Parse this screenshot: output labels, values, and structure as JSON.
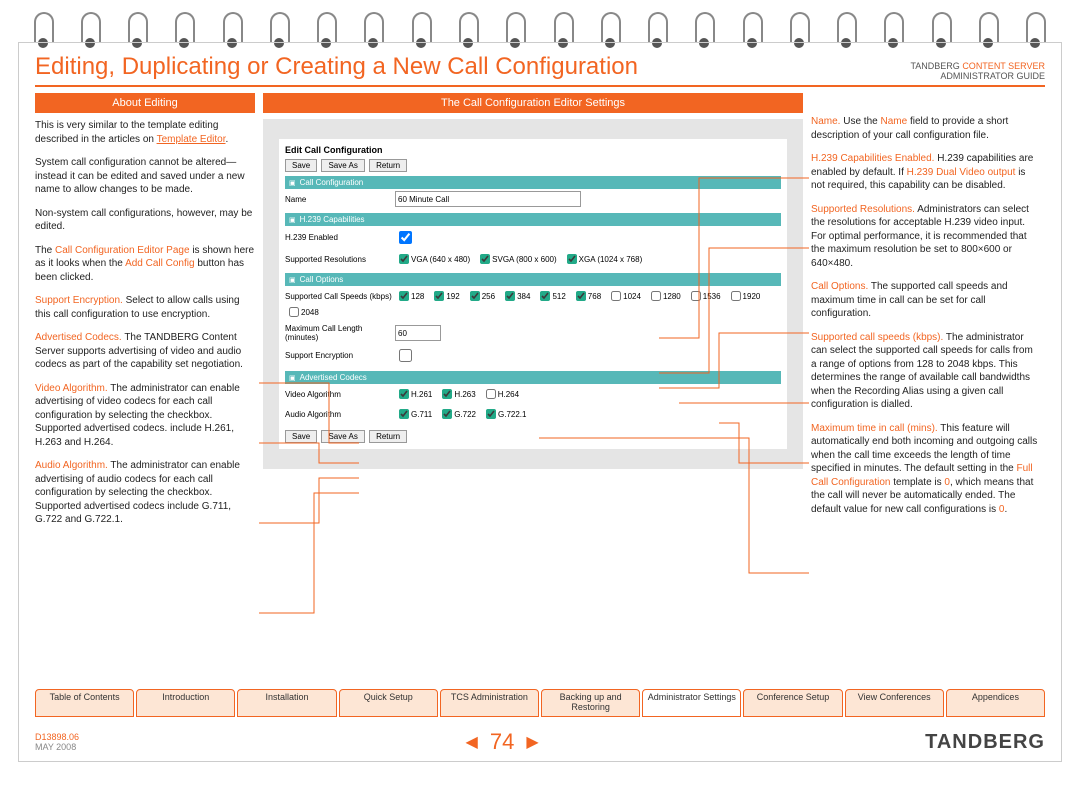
{
  "header": {
    "title": "Editing, Duplicating or Creating a New Call Configuration",
    "brand_prefix": "TANDBERG ",
    "brand_cs": "CONTENT SERVER",
    "brand_sub": "ADMINISTRATOR GUIDE"
  },
  "left": {
    "header": "About Editing",
    "p1a": "This is very similar to the template editing described in the articles on ",
    "p1link": "Template Editor",
    "p1b": ".",
    "p2": "System call configuration cannot be altered— instead it can be edited and saved under a new name to allow changes to be made.",
    "p3": "Non-system call configurations, however, may be edited.",
    "p4a": "The ",
    "p4em1": "Call Configuration Editor Page",
    "p4b": " is shown here as it looks when the ",
    "p4em2": "Add Call Config",
    "p4c": " button has been clicked.",
    "se_t": "Support Encryption.",
    "se": " Select to allow calls using this call configuration to use encryption.",
    "ac_t": "Advertised Codecs.",
    "ac": " The TANDBERG Content Server supports advertising of video and audio codecs as part of the capability set negotiation.",
    "va_t": "Video Algorithm.",
    "va": " The administrator can enable advertising of video codecs for each call configuration by selecting the checkbox. Supported advertised codecs. include H.261, H.263 and H.264.",
    "aa_t": "Audio Algorithm.",
    "aa": " The administrator can enable advertising of audio codecs for each call configuration by selecting the checkbox. Supported advertised codecs include G.711, G.722 and G.722.1."
  },
  "mid": {
    "header": "The Call Configuration Editor Settings",
    "title": "Edit Call Configuration",
    "btn_save": "Save",
    "btn_saveas": "Save As",
    "btn_return": "Return",
    "s_call": "Call Configuration",
    "lbl_name": "Name",
    "val_name": "60 Minute Call",
    "s_h239": "H.239 Capabilities",
    "lbl_h239e": "H.239 Enabled",
    "lbl_supres": "Supported Resolutions",
    "res1": "VGA (640 x 480)",
    "res2": "SVGA (800 x 600)",
    "res3": "XGA (1024 x 768)",
    "s_callopt": "Call Options",
    "lbl_speeds": "Supported Call Speeds (kbps)",
    "speeds": [
      "128",
      "192",
      "256",
      "384",
      "512",
      "768",
      "1024",
      "1280",
      "1536",
      "1920",
      "2048"
    ],
    "lbl_maxlen": "Maximum Call Length (minutes)",
    "val_maxlen": "60",
    "lbl_supenc": "Support Encryption",
    "s_adv": "Advertised Codecs",
    "lbl_valg": "Video Algorithm",
    "v1": "H.261",
    "v2": "H.263",
    "v3": "H.264",
    "lbl_aalg": "Audio Algorithm",
    "a1": "G.711",
    "a2": "G.722",
    "a3": "G.722.1"
  },
  "right": {
    "nm_t": "Name.",
    "nm_a": " Use the ",
    "nm_em": "Name",
    "nm_b": " field to provide a short description of your call configuration file.",
    "h2_t": "H.239 Capabilities Enabled.",
    "h2_a": " H.239 capabilities are enabled by default. If ",
    "h2_em": "H.239 Dual Video output",
    "h2_b": " is not required, this capability can be disabled.",
    "sr_t": "Supported Resolutions.",
    "sr": " Administrators can select the resolutions for acceptable H.239 video input. For optimal performance, it is recommended that the maximum resolution be set to 800×600 or 640×480.",
    "co_t": "Call Options.",
    "co": " The supported call speeds and maximum time in call can be set for call configuration.",
    "sp_t": "Supported call speeds (kbps).",
    "sp": " The administrator can select the supported call speeds for calls from a range of options from 128 to 2048 kbps. This determines the range of available call bandwidths when the Recording Alias using a given call configuration is dialled.",
    "mx_t": "Maximum time in call (mins).",
    "mx_a": " This feature will automatically end both incoming and outgoing calls when the call time exceeds the length of time specified in minutes. The default setting in the ",
    "mx_em1": "Full Call Configuration",
    "mx_b": " template is ",
    "mx_em2": "0",
    "mx_c": ", which means that the call will never be automatically ended. The default value for new call configurations is ",
    "mx_em3": "0",
    "mx_d": "."
  },
  "tabs": [
    "Table of Contents",
    "Introduction",
    "Installation",
    "Quick Setup",
    "TCS Administration",
    "Backing up and Restoring",
    "Administrator Settings",
    "Conference Setup",
    "View Conferences",
    "Appendices"
  ],
  "footer": {
    "doc": "D13898.06",
    "date": "MAY 2008",
    "page": "74",
    "logo": "TANDBERG"
  }
}
